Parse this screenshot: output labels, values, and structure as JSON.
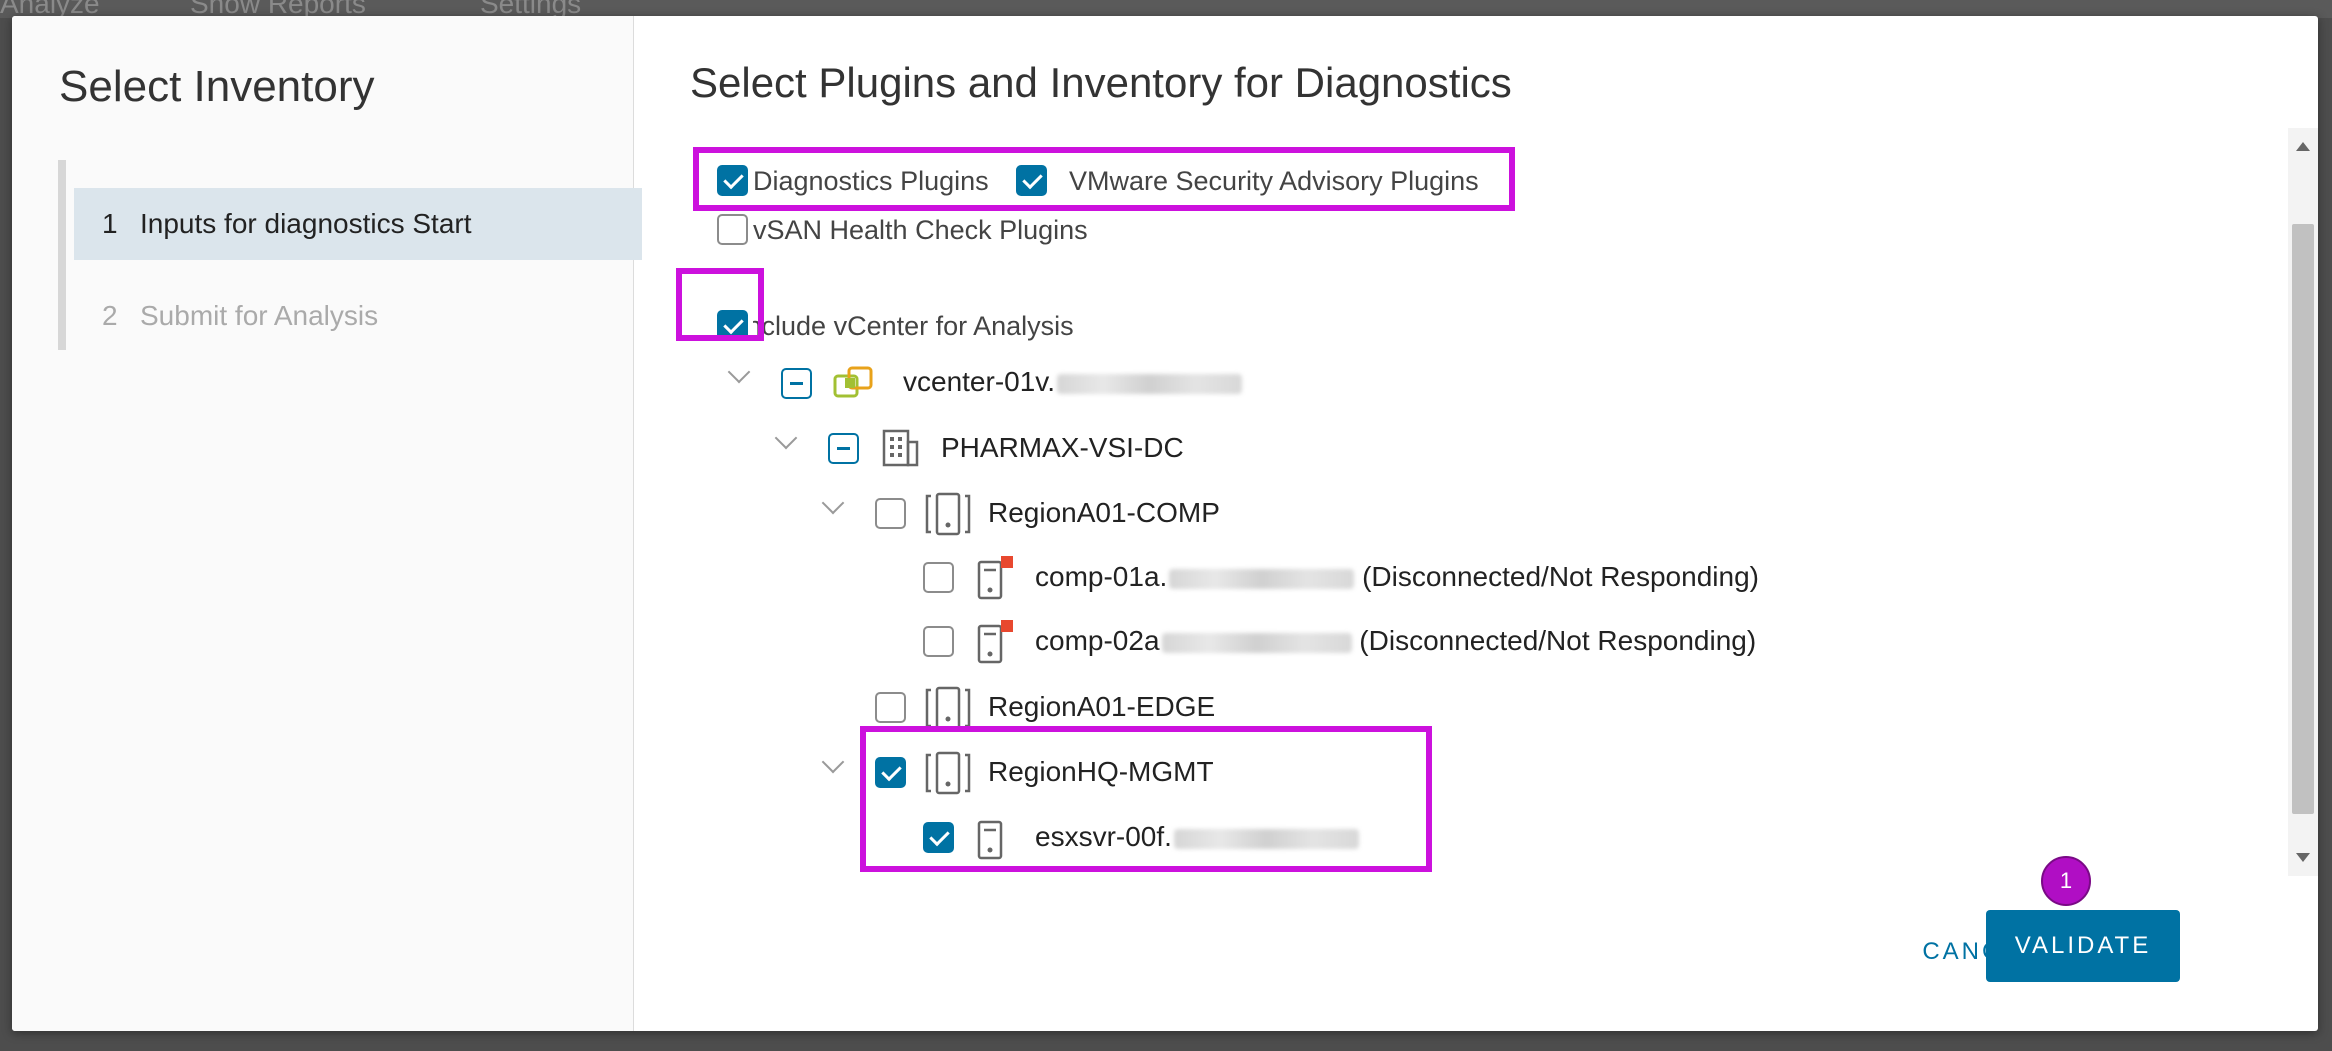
{
  "background": {
    "tabs": [
      "Analyze",
      "Show Reports",
      "Settings"
    ]
  },
  "wizard": {
    "title": "Select Inventory",
    "steps": [
      {
        "number": "1",
        "label": "Inputs for diagnostics Start"
      },
      {
        "number": "2",
        "label": "Submit for Analysis"
      }
    ]
  },
  "main": {
    "title": "Select Plugins and Inventory for Diagnostics",
    "plugins": [
      {
        "label": "Diagnostics Plugins",
        "checked": true
      },
      {
        "label": "VMware Security Advisory Plugins",
        "checked": true
      },
      {
        "label": "vSAN Health Check Plugins",
        "checked": false
      }
    ],
    "include_vcenter": {
      "label": "Include vCenter for Analysis",
      "checked": true
    },
    "tree": {
      "vcenter": {
        "label": "vcenter-01v.",
        "icon": "vcenter-icon",
        "state": "indeterminate"
      },
      "datacenter": {
        "label": "PHARMAX-VSI-DC",
        "icon": "datacenter-icon",
        "state": "indeterminate"
      },
      "clusters": [
        {
          "label": "RegionA01-COMP",
          "icon": "cluster-icon",
          "checked": false,
          "expanded": true,
          "hosts": [
            {
              "label": "comp-01a.",
              "status": "(Disconnected/Not Responding)",
              "icon": "host-disconnected-icon",
              "checked": false
            },
            {
              "label": "comp-02a",
              "status": "(Disconnected/Not Responding)",
              "icon": "host-disconnected-icon",
              "checked": false
            }
          ]
        },
        {
          "label": "RegionA01-EDGE",
          "icon": "cluster-icon",
          "checked": false,
          "expanded": false
        },
        {
          "label": "RegionHQ-MGMT",
          "icon": "cluster-icon",
          "checked": true,
          "expanded": true,
          "hosts": [
            {
              "label": "esxsvr-00f.",
              "icon": "host-icon",
              "checked": true
            }
          ]
        }
      ]
    }
  },
  "footer": {
    "cancel_label": "CANCEL",
    "validate_label": "VALIDATE",
    "annotation_badge": "1"
  },
  "colors": {
    "accent": "#0072a3",
    "highlight": "#cc11dd",
    "badge": "#b00ec4",
    "active_step_bg": "#dbe5ec"
  }
}
